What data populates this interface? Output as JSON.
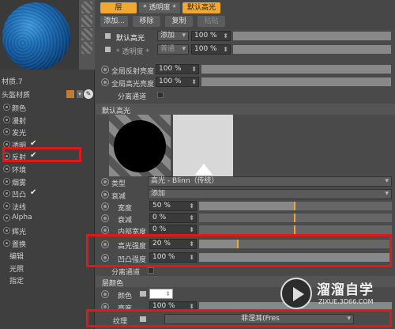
{
  "material": {
    "name": "材质.7",
    "field_label": "头盔材质",
    "swatch_color": "#c87a30"
  },
  "channels": [
    {
      "label": "颜色",
      "checked": false
    },
    {
      "label": "漫射",
      "checked": false
    },
    {
      "label": "发光",
      "checked": false
    },
    {
      "label": "透明",
      "checked": true
    },
    {
      "label": "反射",
      "checked": true
    },
    {
      "label": "环境",
      "checked": false
    },
    {
      "label": "烟雾",
      "checked": false
    },
    {
      "label": "凹凸",
      "checked": true
    },
    {
      "label": "法线",
      "checked": false
    },
    {
      "label": "Alpha",
      "checked": false
    },
    {
      "label": "辉光",
      "checked": false
    },
    {
      "label": "置换",
      "checked": false
    }
  ],
  "extra_items": [
    "编辑",
    "光照",
    "指定"
  ],
  "tabs": {
    "layer": "层",
    "transparency": "* 透明度 *",
    "default_spec": "默认高光",
    "add": "添加...",
    "remove": "移除",
    "copy": "复制",
    "paste": "粘贴"
  },
  "layers": [
    {
      "name": "默认高光",
      "mode": "添加",
      "value": "100 %"
    },
    {
      "name": "* 透明度 *",
      "mode": "普通",
      "value": "100 %"
    }
  ],
  "global": {
    "refl_label": "全局反射亮度",
    "refl_value": "100 %",
    "spec_label": "全局高光亮度",
    "spec_value": "100 %",
    "separate": "分离通道"
  },
  "section_title": "默认高光",
  "props": {
    "type_label": "类型",
    "type_value": "高光 - Blinn（传统）",
    "atten_label": "衰减",
    "atten_value": "添加",
    "width_label": "宽度",
    "width_value": "50 %",
    "falloff_label": "衰减",
    "falloff_value": "0 %",
    "inner_label": "内部宽度",
    "inner_value": "0 %",
    "spec_strength_label": "高光强度",
    "spec_strength_value": "20 %",
    "bump_strength_label": "凹凸强度",
    "bump_strength_value": "100 %",
    "separate": "分离通道"
  },
  "layer_color": {
    "title": "层颜色",
    "color_label": "颜色",
    "brightness_label": "亮度",
    "brightness_value": "100 %",
    "texture_label": "纹理",
    "texture_value": "菲涅耳(Fres"
  },
  "watermark": {
    "title": "溜溜自学",
    "url": "ZIXUE.3D66.COM"
  }
}
